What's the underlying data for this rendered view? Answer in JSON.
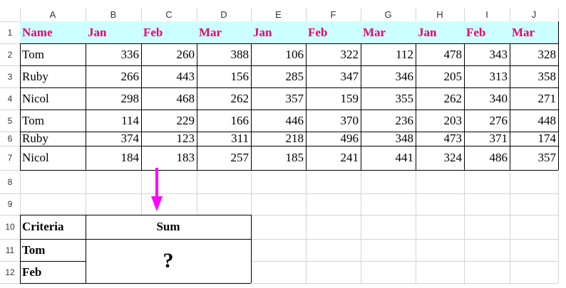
{
  "column_headers": [
    "A",
    "B",
    "C",
    "D",
    "E",
    "F",
    "G",
    "H",
    "I",
    "J"
  ],
  "row_numbers": [
    "1",
    "2",
    "3",
    "4",
    "5",
    "6",
    "7",
    "8",
    "9",
    "10",
    "11",
    "12"
  ],
  "header_row": [
    "Name",
    "Jan",
    "Feb",
    "Mar",
    "Jan",
    "Feb",
    "Mar",
    "Jan",
    "Feb",
    "Mar"
  ],
  "rows": [
    {
      "name": "Tom",
      "values": [
        "336",
        "260",
        "388",
        "106",
        "322",
        "112",
        "478",
        "343",
        "328"
      ]
    },
    {
      "name": "Ruby",
      "values": [
        "266",
        "443",
        "156",
        "285",
        "347",
        "346",
        "205",
        "313",
        "358"
      ]
    },
    {
      "name": "Nicol",
      "values": [
        "298",
        "468",
        "262",
        "357",
        "159",
        "355",
        "262",
        "340",
        "271"
      ]
    },
    {
      "name": "Tom",
      "values": [
        "114",
        "229",
        "166",
        "446",
        "370",
        "236",
        "203",
        "276",
        "448"
      ]
    },
    {
      "name": "Ruby",
      "values": [
        "374",
        "123",
        "311",
        "218",
        "496",
        "348",
        "473",
        "371",
        "174"
      ]
    },
    {
      "name": "Nicol",
      "values": [
        "184",
        "183",
        "257",
        "185",
        "241",
        "441",
        "324",
        "486",
        "357"
      ]
    }
  ],
  "criteria_table": {
    "criteria_label": "Criteria",
    "sum_label": "Sum",
    "criteria_1": "Tom",
    "criteria_2": "Feb",
    "result": "?"
  },
  "colors": {
    "header_fill": "#ccffff",
    "header_text": "#e8006e",
    "arrow": "#ff00ff",
    "gridline": "#d4d4d4",
    "border": "#000000",
    "heading_bg": "#ffffff"
  },
  "arrow_icon": "down-arrow-icon"
}
